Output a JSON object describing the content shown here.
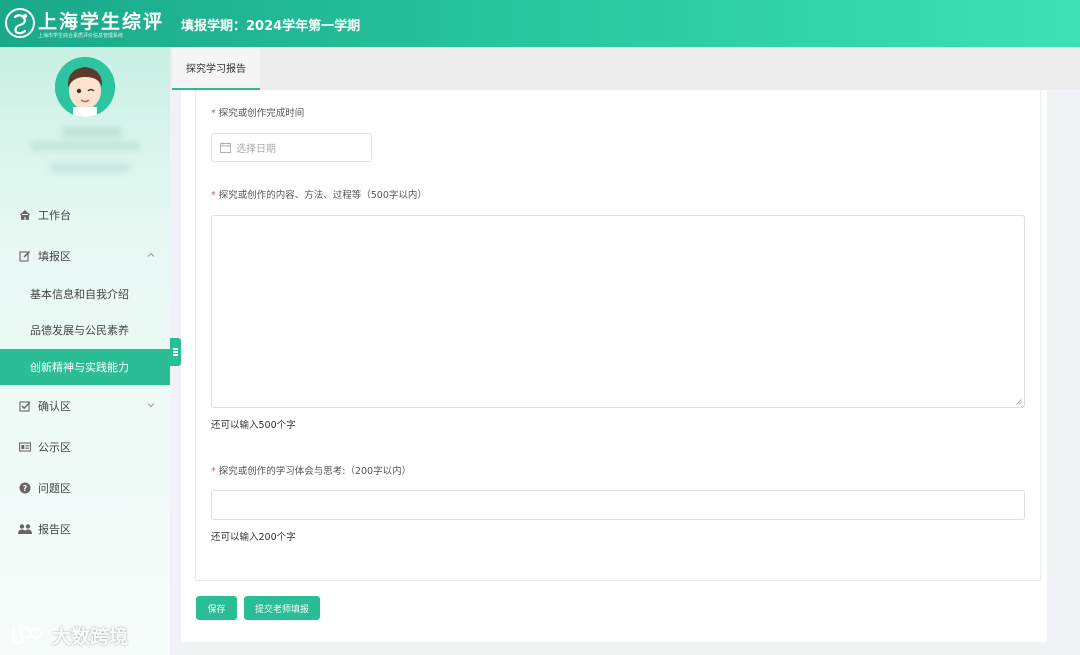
{
  "header": {
    "app_title": "上海学生综评",
    "app_subtitle": "上海市学生综合素质评价信息管理系统",
    "term_label": "填报学期：2024学年第一学期"
  },
  "sidebar": {
    "items": [
      {
        "label": "工作台",
        "icon": "home-icon"
      },
      {
        "label": "填报区",
        "icon": "edit-icon",
        "expanded": true
      },
      {
        "label": "确认区",
        "icon": "checkbox-icon"
      },
      {
        "label": "公示区",
        "icon": "board-icon"
      },
      {
        "label": "问题区",
        "icon": "question-icon"
      },
      {
        "label": "报告区",
        "icon": "users-icon"
      }
    ],
    "sub_items": [
      {
        "label": "基本信息和自我介绍"
      },
      {
        "label": "品德发展与公民素养"
      },
      {
        "label": "创新精神与实践能力",
        "active": true
      }
    ]
  },
  "tabs": [
    {
      "label": "探究学习报告"
    }
  ],
  "form": {
    "completion_time_label": "探究或创作完成时间",
    "date_placeholder": "选择日期",
    "content_label": "探究或创作的内容、方法、过程等（500字以内）",
    "content_hint": "还可以输入500个字",
    "reflection_label": "探究或创作的学习体会与思考:（200字以内）",
    "reflection_hint": "还可以输入200个字",
    "required_mark": "*"
  },
  "buttons": {
    "save": "保存",
    "submit_teacher": "提交老师填报"
  },
  "watermark": {
    "text": "大数跨境"
  },
  "colors": {
    "accent": "#2bbd95",
    "required": "#e5534b"
  }
}
